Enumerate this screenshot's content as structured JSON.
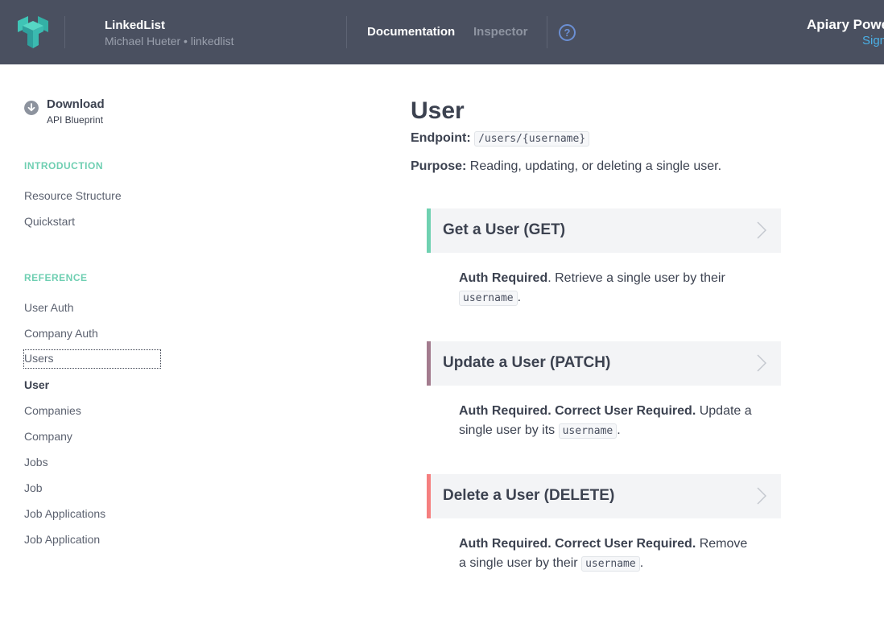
{
  "header": {
    "project_name": "LinkedList",
    "project_sub": "Michael Hueter • linkedlist",
    "nav": [
      {
        "label": "Documentation",
        "active": true
      },
      {
        "label": "Inspector",
        "active": false
      }
    ],
    "help_label": "?",
    "brand": "Apiary Powe",
    "signin": "Sign"
  },
  "sidebar": {
    "download": {
      "title": "Download",
      "subtitle": "API Blueprint"
    },
    "sections": [
      {
        "heading": "INTRODUCTION",
        "items": [
          "Resource Structure",
          "Quickstart"
        ]
      },
      {
        "heading": "REFERENCE",
        "items": [
          "User Auth",
          "Company Auth",
          "Users",
          "User",
          "Companies",
          "Company",
          "Jobs",
          "Job",
          "Job Applications",
          "Job Application"
        ]
      }
    ],
    "current_item": "User",
    "focused_item": "Users"
  },
  "main": {
    "title": "User",
    "endpoint_label": "Endpoint:",
    "endpoint_value": "/users/{username}",
    "purpose_label": "Purpose:",
    "purpose_text": " Reading, updating, or deleting a single user.",
    "actions": [
      {
        "label": "Get a User (GET)",
        "color": "#6fd1b1",
        "desc_bold": "Auth Required",
        "desc_text": ". Retrieve a single user by their ",
        "desc_code": "username",
        "desc_end": "."
      },
      {
        "label": "Update a User (PATCH)",
        "color": "#a37b8e",
        "desc_bold": "Auth Required. Correct User Required.",
        "desc_text": " Update a single user by its ",
        "desc_code": "username",
        "desc_end": "."
      },
      {
        "label": "Delete a User (DELETE)",
        "color": "#f57f7f",
        "desc_bold": "Auth Required. Correct User Required.",
        "desc_text": " Remove a single user by their ",
        "desc_code": "username",
        "desc_end": "."
      }
    ]
  }
}
